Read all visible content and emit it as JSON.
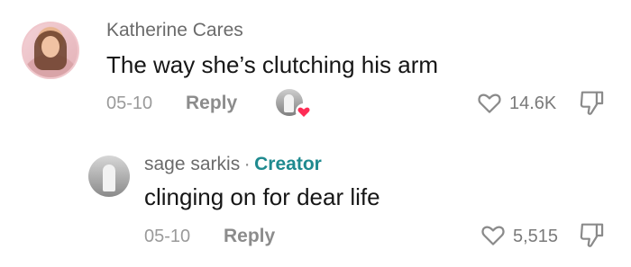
{
  "comments": [
    {
      "username": "Katherine Cares",
      "text": "The way she’s clutching his arm",
      "date": "05-10",
      "reply_label": "Reply",
      "like_count": "14.6K"
    }
  ],
  "reply_comment": {
    "username": "sage sarkis",
    "separator": "·",
    "badge": "Creator",
    "text": "clinging on for dear life",
    "date": "05-10",
    "reply_label": "Reply",
    "like_count": "5,515"
  },
  "colors": {
    "creator_badge": "#1f8a8f",
    "liked_heart": "#fe2c55"
  },
  "icons": {
    "like": "heart-outline-icon",
    "dislike": "thumbs-down-icon",
    "creator_liked_badge": "heart-filled-icon"
  }
}
